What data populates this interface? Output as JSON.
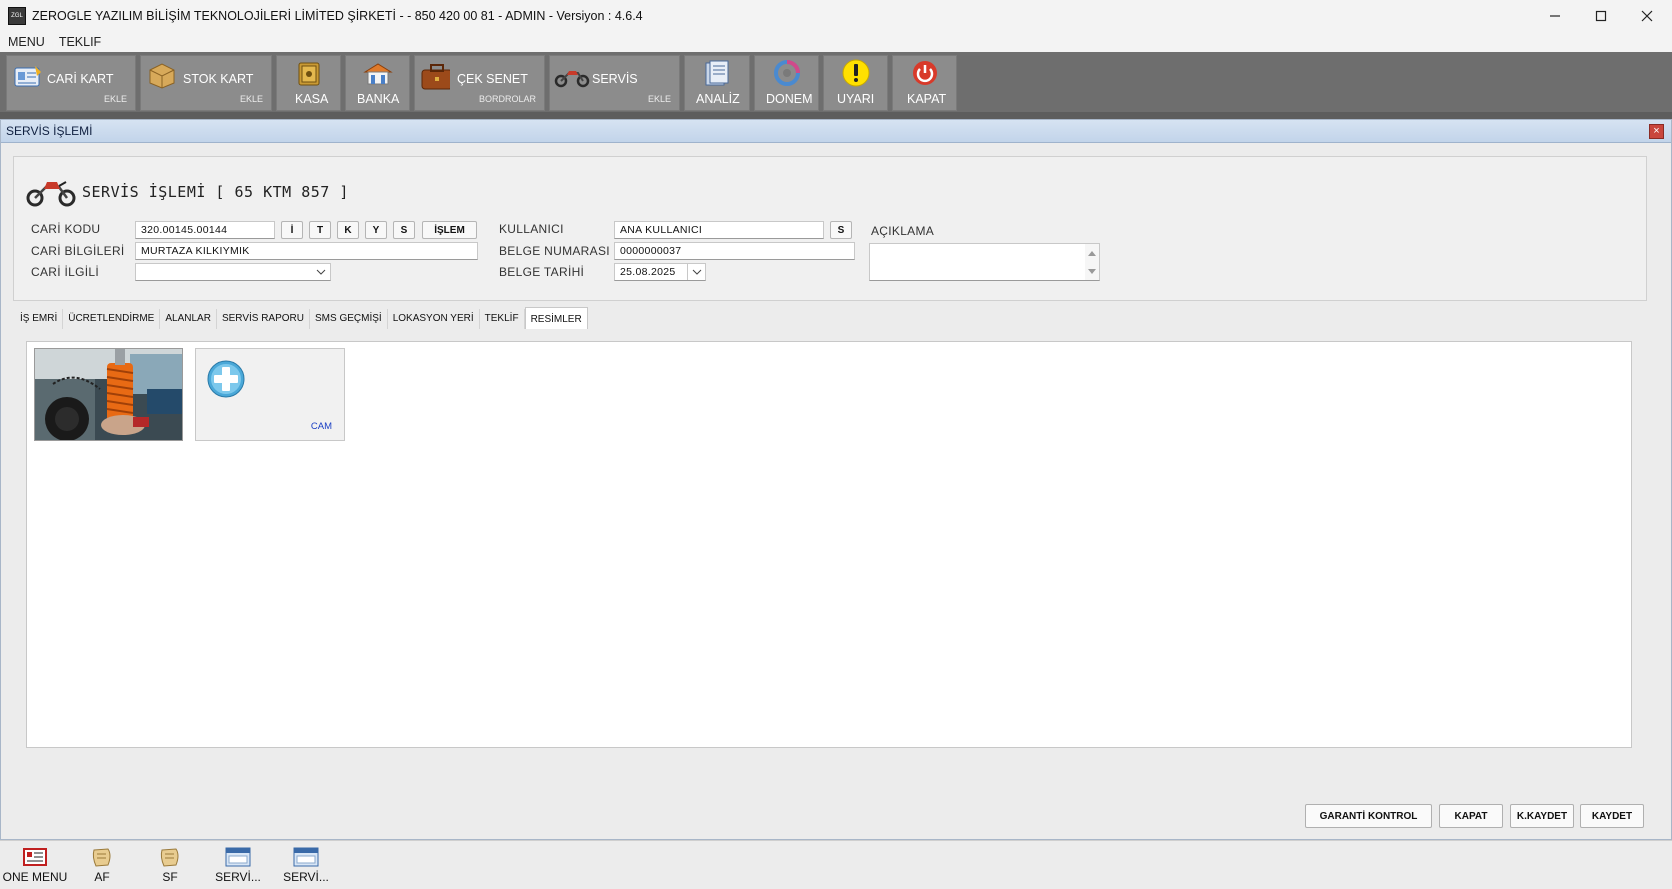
{
  "window": {
    "title": "ZEROGLE YAZILIM BİLİŞİM TEKNOLOJİLERİ LİMİTED ŞİRKETİ -  - 850 420 00 81 - ADMIN -  Versiyon : 4.6.4",
    "minimize_icon": "minimize-icon",
    "maximize_icon": "maximize-icon",
    "close_icon": "close-icon"
  },
  "menu": [
    "MENU",
    "TEKLIF"
  ],
  "toolbar": [
    {
      "label": "CARİ KART",
      "sub": "EKLE",
      "icon": "card-icon"
    },
    {
      "label": "STOK KART",
      "sub": "EKLE",
      "icon": "box-icon"
    },
    {
      "label": "KASA",
      "sub": "",
      "icon": "safe-icon"
    },
    {
      "label": "BANKA",
      "sub": "",
      "icon": "bank-icon"
    },
    {
      "label": "ÇEK SENET",
      "sub": "BORDROLAR",
      "icon": "briefcase-icon"
    },
    {
      "label": "SERVİS",
      "sub": "EKLE",
      "icon": "motorcycle-icon"
    },
    {
      "label": "ANALİZ",
      "sub": "",
      "icon": "chart-icon"
    },
    {
      "label": "DONEM",
      "sub": "",
      "icon": "period-icon"
    },
    {
      "label": "UYARI",
      "sub": "",
      "icon": "warning-icon"
    },
    {
      "label": "KAPAT",
      "sub": "",
      "icon": "power-icon"
    }
  ],
  "child_window": {
    "title": "SERVİS İŞLEMİ",
    "close": "×"
  },
  "form": {
    "heading": "SERVİS İŞLEMİ [ 65 KTM 857 ]",
    "cari_kodu_label": "CARİ KODU",
    "cari_kodu": "320.00145.00144",
    "cari_buttons": [
      "İ",
      "T",
      "K",
      "Y",
      "S",
      "İŞLEM"
    ],
    "cari_bilgileri_label": "CARİ BİLGİLERİ",
    "cari_bilgileri": "MURTAZA KILKIYMIK",
    "cari_ilgili_label": "CARİ İLGİLİ",
    "cari_ilgili": "",
    "kullanici_label": "KULLANICI",
    "kullanici": "ANA KULLANICI",
    "kullanici_button": "S",
    "belge_numarasi_label": "BELGE NUMARASI",
    "belge_numarasi": "0000000037",
    "belge_tarihi_label": "BELGE TARİHİ",
    "belge_tarihi": "25.08.2025",
    "aciklama_label": "AÇIKLAMA",
    "aciklama": ""
  },
  "tabs": [
    "İŞ EMRİ",
    "ÜCRETLENDİRME",
    "ALANLAR",
    "SERVİS RAPORU",
    "SMS GEÇMİŞİ",
    "LOKASYON YERİ",
    "TEKLİF",
    "RESİMLER"
  ],
  "active_tab": "RESİMLER",
  "images": {
    "add_label": "CAM"
  },
  "bottom_buttons": [
    "GARANTİ KONTROL",
    "KAPAT",
    "K.KAYDET",
    "KAYDET"
  ],
  "taskbar": [
    {
      "label": "ONE MENU",
      "icon": "menu-card-icon"
    },
    {
      "label": "AF",
      "icon": "scroll-icon"
    },
    {
      "label": "SF",
      "icon": "scroll-icon"
    },
    {
      "label": "SERVİ...",
      "icon": "window-icon"
    },
    {
      "label": "SERVİ...",
      "icon": "window-icon"
    }
  ]
}
